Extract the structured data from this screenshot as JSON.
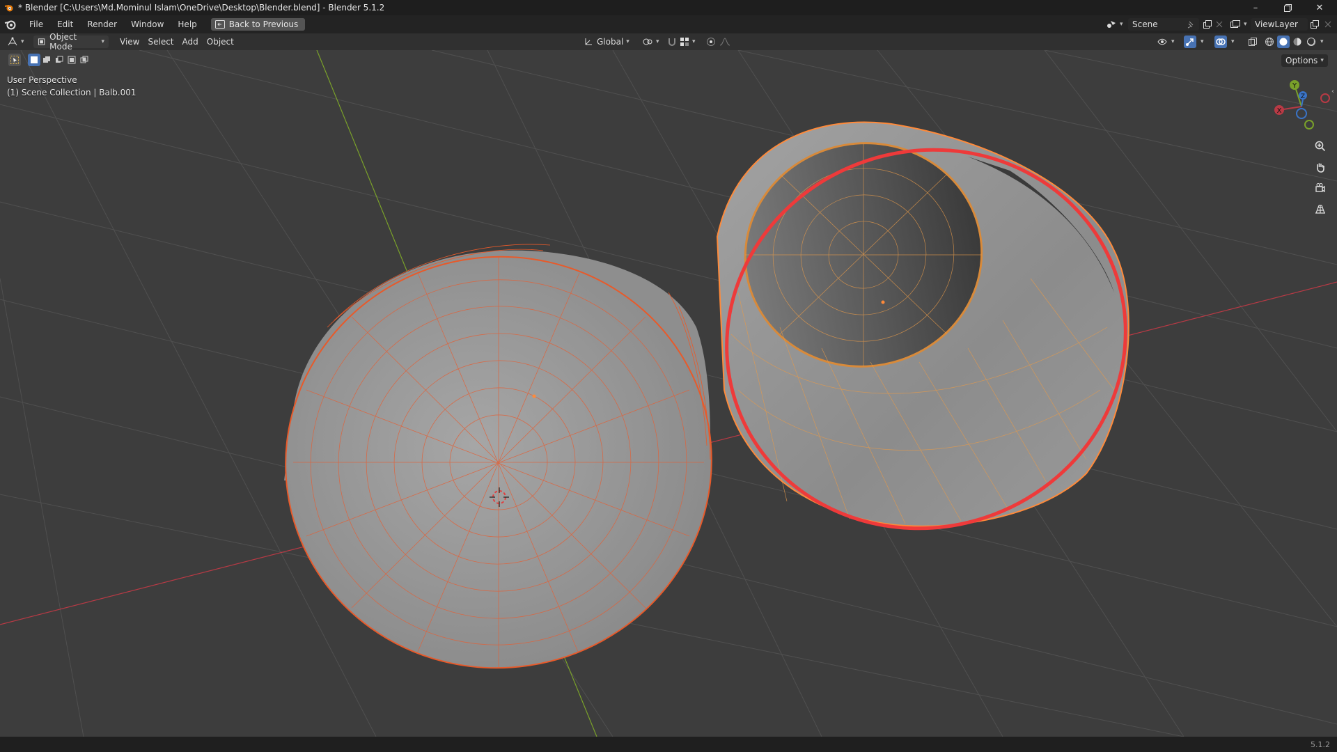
{
  "window": {
    "title": "* Blender [C:\\Users\\Md.Mominul Islam\\OneDrive\\Desktop\\Blender.blend] - Blender 5.1.2",
    "controls": [
      "minimize-icon",
      "restore-icon",
      "close-icon"
    ]
  },
  "menu": {
    "items": [
      "File",
      "Edit",
      "Render",
      "Window",
      "Help"
    ],
    "back_button": "Back to Previous",
    "scene": "Scene",
    "view_layer": "ViewLayer"
  },
  "header": {
    "mode": "Object Mode",
    "menus": [
      "View",
      "Select",
      "Add",
      "Object"
    ],
    "transform_orientation": "Global",
    "options": "Options"
  },
  "viewport": {
    "view_name": "User Perspective",
    "collection_info": "(1) Scene Collection | Balb.001",
    "axes": [
      "X",
      "Y",
      "Z"
    ],
    "colors": {
      "background": "#3d3d3d",
      "grid": "#505050",
      "x_axis": "#b83a45",
      "y_axis": "#7aa12a",
      "selected_active": "#ff8a3a",
      "selected": "#e85a2a",
      "mesh": "#9a9a9a"
    }
  },
  "statusbar": {
    "version": "5.1.2"
  }
}
